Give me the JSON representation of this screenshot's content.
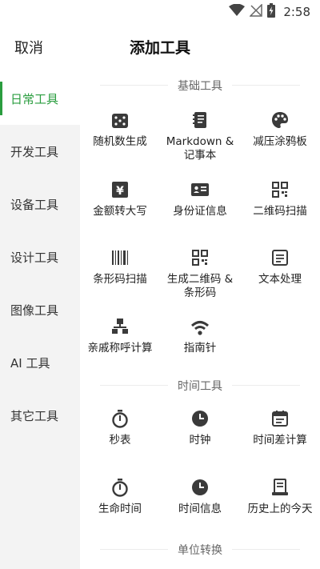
{
  "status_bar": {
    "time": "2:58",
    "icons": [
      "wifi-icon",
      "no-signal-icon",
      "battery-charging-icon"
    ]
  },
  "header": {
    "cancel_label": "取消",
    "title": "添加工具"
  },
  "sidebar": {
    "active_color": "#2a9d3f",
    "items": [
      {
        "label": "日常工具",
        "active": true
      },
      {
        "label": "开发工具",
        "active": false
      },
      {
        "label": "设备工具",
        "active": false
      },
      {
        "label": "设计工具",
        "active": false
      },
      {
        "label": "图像工具",
        "active": false
      },
      {
        "label": "AI 工具",
        "active": false
      },
      {
        "label": "其它工具",
        "active": false
      }
    ]
  },
  "sections": [
    {
      "title": "基础工具",
      "tools": [
        {
          "label": "随机数生成",
          "icon": "dice-icon"
        },
        {
          "label": "Markdown & 记事本",
          "icon": "notebook-icon"
        },
        {
          "label": "减压涂鸦板",
          "icon": "palette-icon"
        },
        {
          "label": "金额转大写",
          "icon": "yen-icon"
        },
        {
          "label": "身份证信息",
          "icon": "id-card-icon"
        },
        {
          "label": "二维码扫描",
          "icon": "qr-code-icon"
        },
        {
          "label": "条形码扫描",
          "icon": "barcode-icon"
        },
        {
          "label": "生成二维码 & 条形码",
          "icon": "qr-code-icon"
        },
        {
          "label": "文本处理",
          "icon": "text-box-icon"
        },
        {
          "label": "亲戚称呼计算",
          "icon": "family-tree-icon"
        },
        {
          "label": "指南针",
          "icon": "compass-icon"
        }
      ]
    },
    {
      "title": "时间工具",
      "tools": [
        {
          "label": "秒表",
          "icon": "stopwatch-icon"
        },
        {
          "label": "时钟",
          "icon": "clock-icon"
        },
        {
          "label": "时间差计算",
          "icon": "calendar-icon"
        },
        {
          "label": "生命时间",
          "icon": "stopwatch-icon"
        },
        {
          "label": "时间信息",
          "icon": "clock-icon"
        },
        {
          "label": "历史上的今天",
          "icon": "scroll-icon"
        }
      ]
    },
    {
      "title": "单位转换",
      "tools": []
    }
  ]
}
